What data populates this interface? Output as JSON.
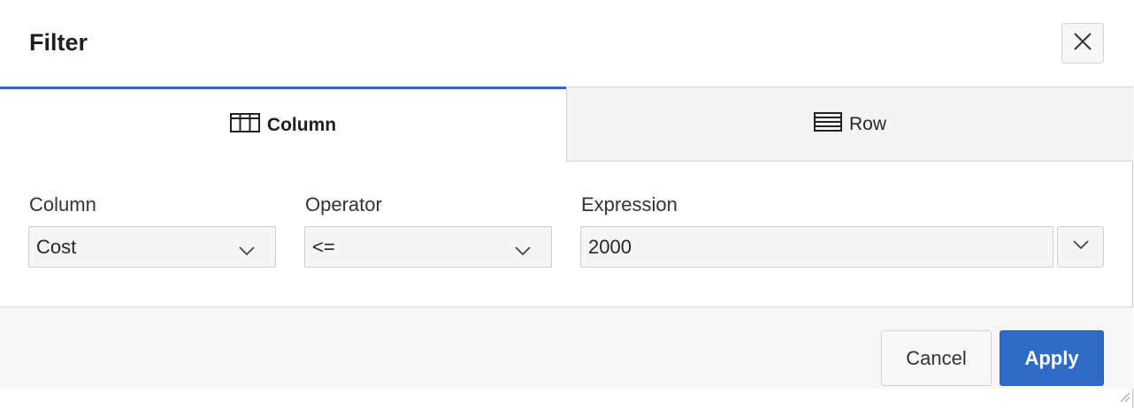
{
  "dialog": {
    "title": "Filter",
    "close_icon": "close-icon"
  },
  "tabs": [
    {
      "label": "Column",
      "icon": "table-columns-icon",
      "active": true
    },
    {
      "label": "Row",
      "icon": "table-rows-icon",
      "active": false
    }
  ],
  "fields": {
    "column": {
      "label": "Column",
      "value": "Cost"
    },
    "operator": {
      "label": "Operator",
      "value": "<="
    },
    "expression": {
      "label": "Expression",
      "value": "2000"
    }
  },
  "footer": {
    "cancel_label": "Cancel",
    "apply_label": "Apply"
  },
  "colors": {
    "accent": "#2f6bc6",
    "active_tab_border": "#2f6bb8"
  }
}
